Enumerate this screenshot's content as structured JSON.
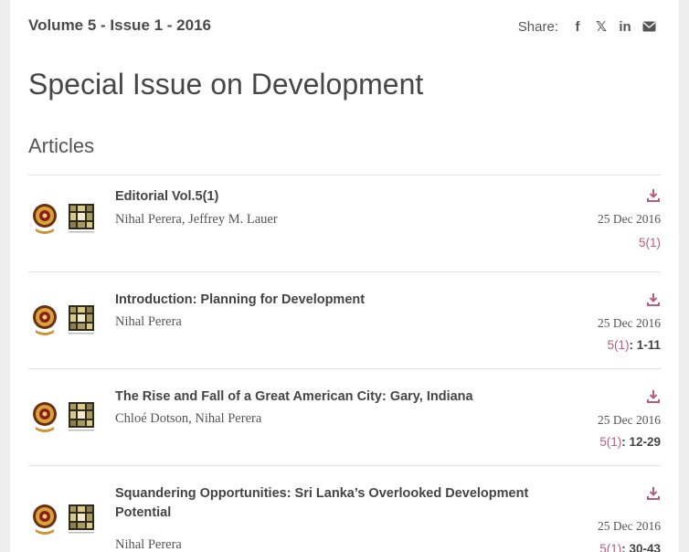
{
  "header": {
    "issue_label": "Volume 5 - Issue 1 - 2016",
    "share_label": "Share:",
    "share_icons": [
      "facebook-icon",
      "x-icon",
      "linkedin-icon",
      "email-icon"
    ],
    "share_glyphs": {
      "facebook": "f",
      "x": "𝕏",
      "linkedin": "in"
    }
  },
  "page_title": "Special Issue on Development",
  "section_title": "Articles",
  "colors": {
    "accent": "#b85c7a",
    "text": "#444444",
    "divider": "#e2e2e2"
  },
  "articles": [
    {
      "title": "Editorial Vol.5(1)",
      "authors": "Nihal Perera, Jeffrey M. Lauer",
      "date": "25 Dec 2016",
      "issue_ref": "5(1)",
      "pages": ""
    },
    {
      "title": "Introduction: Planning for Development",
      "authors": "Nihal Perera",
      "date": "25 Dec 2016",
      "issue_ref": "5(1)",
      "pages": ": 1-11"
    },
    {
      "title": "The Rise and Fall of a Great American City: Gary, Indiana",
      "authors": "Chloé Dotson, Nihal Perera",
      "date": "25 Dec 2016",
      "issue_ref": "5(1)",
      "pages": ": 12-29"
    },
    {
      "title": "Squandering Opportunities: Sri Lanka’s Overlooked Development Potential",
      "authors": "Nihal Perera",
      "date": "25 Dec 2016",
      "issue_ref": "5(1)",
      "pages": ": 30-43"
    }
  ]
}
